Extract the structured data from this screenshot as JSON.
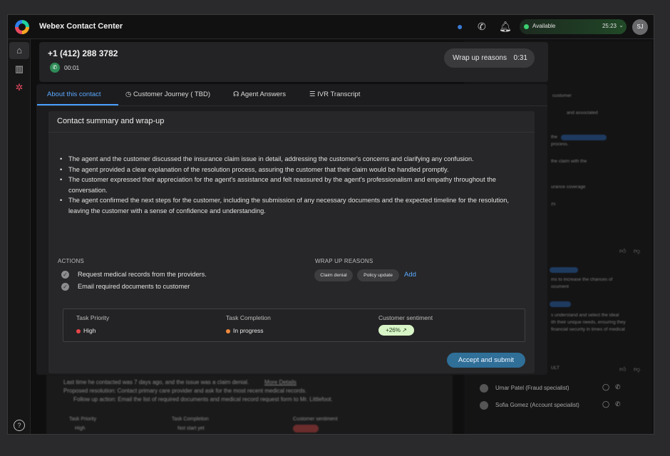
{
  "app": {
    "title": "Webex Contact Center"
  },
  "topbar": {
    "status_label": "Available",
    "status_time": "25:23",
    "avatar_initials": "SJ"
  },
  "call": {
    "phone": "+1 (412) 288 3782",
    "duration": "00:01",
    "wrap_label": "Wrap up reasons",
    "wrap_timer": "0:31"
  },
  "tabs": [
    {
      "label": "About this contact"
    },
    {
      "label": "Customer Journey ( TBD)"
    },
    {
      "label": "Agent Answers"
    },
    {
      "label": "IVR Transcript"
    }
  ],
  "card": {
    "title": "Contact summary and wrap-up",
    "summary": [
      "The agent and the customer discussed the insurance claim issue in detail, addressing the customer's concerns and clarifying any confusion.",
      "The agent provided a clear explanation of the resolution process, assuring the customer that their claim would be handled promptly.",
      "The customer expressed their appreciation for the agent's assistance and felt reassured by the agent's professionalism and empathy throughout the conversation.",
      "The agent confirmed the next steps for the customer, including the submission of any necessary documents and the expected timeline for the resolution, leaving the customer with a sense of confidence and understanding."
    ],
    "actions_label": "ACTIONS",
    "actions": [
      "Request medical records from the providers.",
      "Email required documents to customer"
    ],
    "wrap_label": "WRAP UP REASONS",
    "wrap_reasons": [
      "Claim denial",
      "Policy update"
    ],
    "add_label": "Add",
    "meta": {
      "priority_label": "Task Priority",
      "priority_value": "High",
      "completion_label": "Task Completion",
      "completion_value": "In progress",
      "sentiment_label": "Customer sentiment",
      "sentiment_value": "+26%"
    },
    "submit_label": "Accept and submit"
  },
  "background": {
    "right_text": [
      "customer",
      "and associated",
      "the",
      "process.",
      "the claim with the",
      "urance coverage",
      "zs",
      "ms to increase the chances of",
      "ocument",
      "s understand and select the ideal",
      "ith their unique needs, ensuring they",
      "financial security in times of medical",
      "ULT"
    ],
    "bottom_text": [
      "Last time he contacted was 7 days ago, and the issue was a claim denial.",
      "More Details",
      "Proposed resolution: Contact primary care provider and ask for the most recent medical records.",
      "Follow up action: Email the list of required documents and medical record request form to Mr. Littlefoot.",
      "Task Priority",
      "Task Completion",
      "Customer sentiment",
      "High",
      "Not start yet"
    ],
    "people": [
      {
        "name": "Umar Patel (Fraud specialist)"
      },
      {
        "name": "Sofia Gomez (Account specialist)"
      }
    ]
  },
  "colors": {
    "accent": "#4a9eff",
    "available": "#3cd070",
    "submit": "#2f6f98",
    "high": "#e8464a",
    "in_progress": "#f08a3c",
    "sentiment_bg": "#d8f5c7"
  }
}
